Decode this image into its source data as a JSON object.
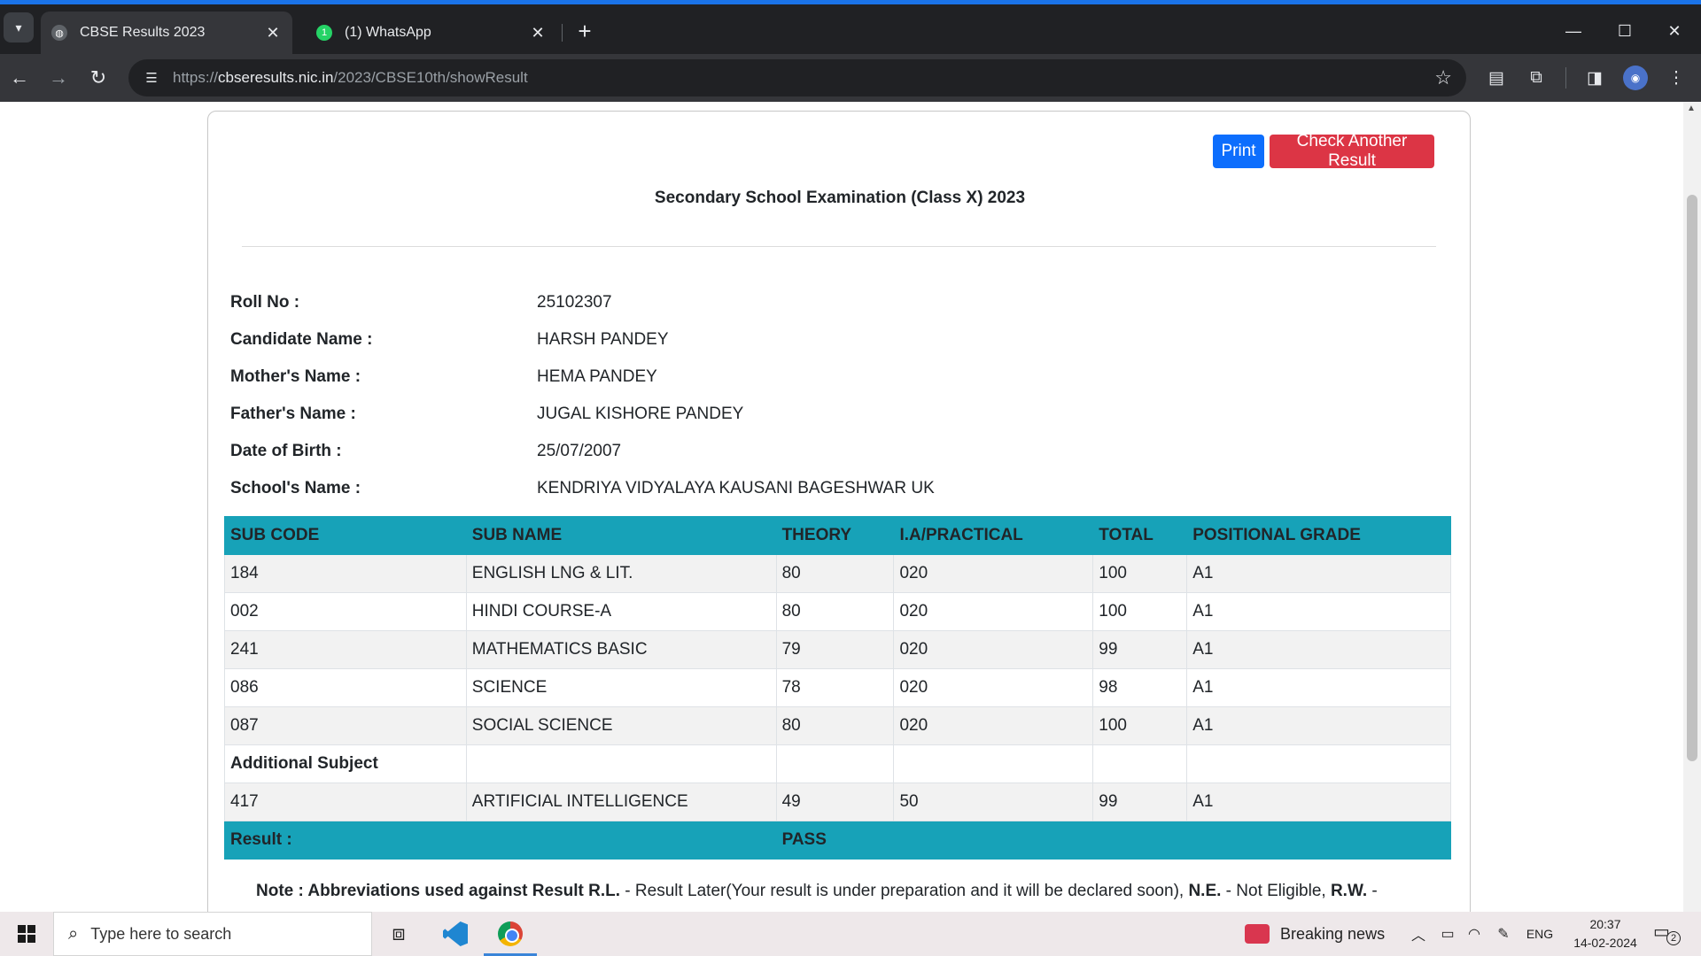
{
  "browser": {
    "tabs": [
      {
        "title": "CBSE Results 2023",
        "active": true
      },
      {
        "title": "(1) WhatsApp",
        "active": false,
        "badge": "1"
      }
    ],
    "url_prefix": "https://",
    "url_host": "cbseresults.nic.in",
    "url_path": "/2023/CBSE10th/showResult",
    "accent": "#1a73e8"
  },
  "page": {
    "print_label": "Print",
    "check_label": "Check Another Result",
    "exam_title": "Secondary School Examination (Class X) 2023",
    "info": [
      {
        "label": "Roll No :",
        "value": "25102307"
      },
      {
        "label": "Candidate Name :",
        "value": "HARSH PANDEY"
      },
      {
        "label": "Mother's Name :",
        "value": "HEMA PANDEY"
      },
      {
        "label": "Father's Name :",
        "value": "JUGAL KISHORE PANDEY"
      },
      {
        "label": "Date of Birth :",
        "value": "25/07/2007"
      },
      {
        "label": "School's Name :",
        "value": "KENDRIYA VIDYALAYA KAUSANI BAGESHWAR UK"
      }
    ],
    "table": {
      "headers": [
        "SUB CODE",
        "SUB NAME",
        "THEORY",
        "I.A/PRACTICAL",
        "TOTAL",
        "POSITIONAL GRADE"
      ],
      "rows": [
        [
          "184",
          "ENGLISH LNG & LIT.",
          "80",
          "020",
          "100",
          "A1"
        ],
        [
          "002",
          "HINDI COURSE-A",
          "80",
          "020",
          "100",
          "A1"
        ],
        [
          "241",
          "MATHEMATICS BASIC",
          "79",
          "020",
          "99",
          "A1"
        ],
        [
          "086",
          "SCIENCE",
          "78",
          "020",
          "98",
          "A1"
        ],
        [
          "087",
          "SOCIAL SCIENCE",
          "80",
          "020",
          "100",
          "A1"
        ]
      ],
      "additional_label": "Additional Subject",
      "additional_rows": [
        [
          "417",
          "ARTIFICIAL INTELLIGENCE",
          "49",
          "50",
          "99",
          "A1"
        ]
      ],
      "result_label": "Result :",
      "result_value": "PASS",
      "header_color": "#17a2b8"
    },
    "note": {
      "lead": "Note : Abbreviations used against Result R.L.",
      "text1": " - Result Later(Your result is under preparation and it will be declared soon), ",
      "ne": "N.E.",
      "text2": " - Not Eligible, ",
      "rw": "R.W.",
      "text3": " -"
    }
  },
  "taskbar": {
    "search_placeholder": "Type here to search",
    "news_label": "Breaking news",
    "lang": "ENG",
    "time": "20:37",
    "date": "14-02-2024",
    "notification_count": "2"
  }
}
